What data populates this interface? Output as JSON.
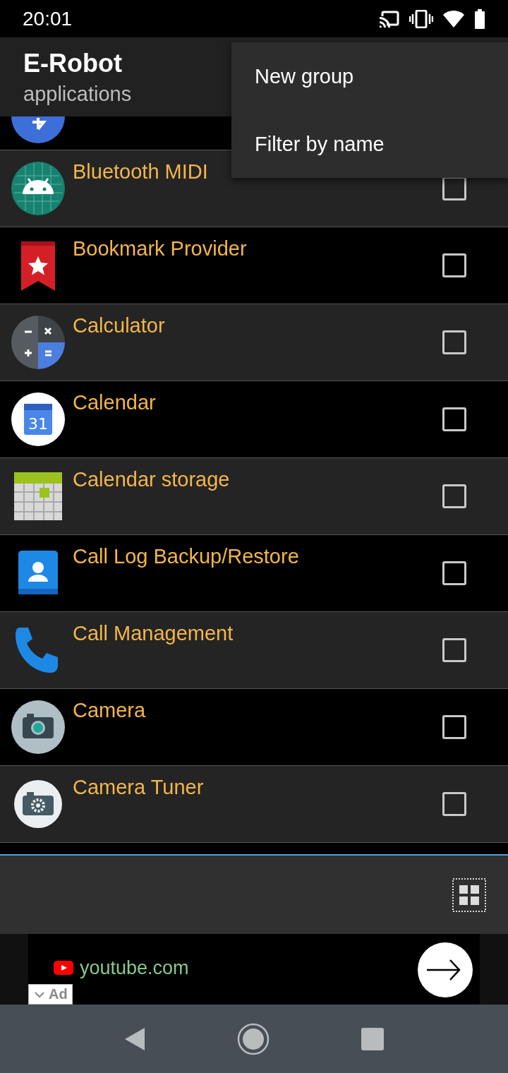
{
  "status_bar": {
    "time": "20:01"
  },
  "app_bar": {
    "title": "E-Robot",
    "subtitle": "applications"
  },
  "menu": {
    "items": [
      "New group",
      "Filter by name"
    ]
  },
  "apps": [
    {
      "name": "Bluetooth MIDI",
      "checked": false
    },
    {
      "name": "Bookmark Provider",
      "checked": false
    },
    {
      "name": "Calculator",
      "checked": false
    },
    {
      "name": "Calendar",
      "checked": false,
      "icon_label": "31"
    },
    {
      "name": "Calendar storage",
      "checked": false
    },
    {
      "name": "Call Log Backup/Restore",
      "checked": false
    },
    {
      "name": "Call Management",
      "checked": false
    },
    {
      "name": "Camera",
      "checked": false
    },
    {
      "name": "Camera Tuner",
      "checked": false
    }
  ],
  "ad": {
    "domain": "youtube.com",
    "badge": "Ad"
  }
}
